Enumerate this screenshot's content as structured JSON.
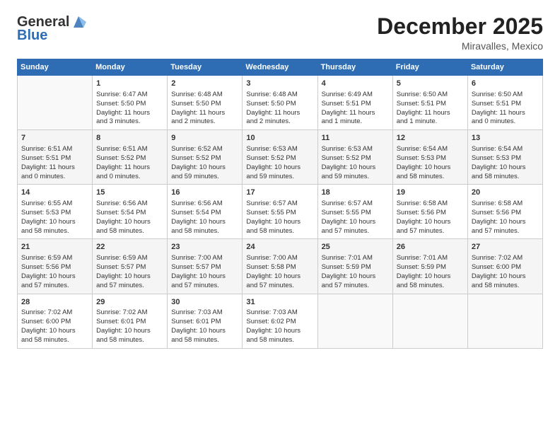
{
  "header": {
    "logo_line1": "General",
    "logo_line2": "Blue",
    "month": "December 2025",
    "location": "Miravalles, Mexico"
  },
  "weekdays": [
    "Sunday",
    "Monday",
    "Tuesday",
    "Wednesday",
    "Thursday",
    "Friday",
    "Saturday"
  ],
  "weeks": [
    [
      {
        "day": "",
        "info": ""
      },
      {
        "day": "1",
        "info": "Sunrise: 6:47 AM\nSunset: 5:50 PM\nDaylight: 11 hours\nand 3 minutes."
      },
      {
        "day": "2",
        "info": "Sunrise: 6:48 AM\nSunset: 5:50 PM\nDaylight: 11 hours\nand 2 minutes."
      },
      {
        "day": "3",
        "info": "Sunrise: 6:48 AM\nSunset: 5:50 PM\nDaylight: 11 hours\nand 2 minutes."
      },
      {
        "day": "4",
        "info": "Sunrise: 6:49 AM\nSunset: 5:51 PM\nDaylight: 11 hours\nand 1 minute."
      },
      {
        "day": "5",
        "info": "Sunrise: 6:50 AM\nSunset: 5:51 PM\nDaylight: 11 hours\nand 1 minute."
      },
      {
        "day": "6",
        "info": "Sunrise: 6:50 AM\nSunset: 5:51 PM\nDaylight: 11 hours\nand 0 minutes."
      }
    ],
    [
      {
        "day": "7",
        "info": "Sunrise: 6:51 AM\nSunset: 5:51 PM\nDaylight: 11 hours\nand 0 minutes."
      },
      {
        "day": "8",
        "info": "Sunrise: 6:51 AM\nSunset: 5:52 PM\nDaylight: 11 hours\nand 0 minutes."
      },
      {
        "day": "9",
        "info": "Sunrise: 6:52 AM\nSunset: 5:52 PM\nDaylight: 10 hours\nand 59 minutes."
      },
      {
        "day": "10",
        "info": "Sunrise: 6:53 AM\nSunset: 5:52 PM\nDaylight: 10 hours\nand 59 minutes."
      },
      {
        "day": "11",
        "info": "Sunrise: 6:53 AM\nSunset: 5:52 PM\nDaylight: 10 hours\nand 59 minutes."
      },
      {
        "day": "12",
        "info": "Sunrise: 6:54 AM\nSunset: 5:53 PM\nDaylight: 10 hours\nand 58 minutes."
      },
      {
        "day": "13",
        "info": "Sunrise: 6:54 AM\nSunset: 5:53 PM\nDaylight: 10 hours\nand 58 minutes."
      }
    ],
    [
      {
        "day": "14",
        "info": "Sunrise: 6:55 AM\nSunset: 5:53 PM\nDaylight: 10 hours\nand 58 minutes."
      },
      {
        "day": "15",
        "info": "Sunrise: 6:56 AM\nSunset: 5:54 PM\nDaylight: 10 hours\nand 58 minutes."
      },
      {
        "day": "16",
        "info": "Sunrise: 6:56 AM\nSunset: 5:54 PM\nDaylight: 10 hours\nand 58 minutes."
      },
      {
        "day": "17",
        "info": "Sunrise: 6:57 AM\nSunset: 5:55 PM\nDaylight: 10 hours\nand 58 minutes."
      },
      {
        "day": "18",
        "info": "Sunrise: 6:57 AM\nSunset: 5:55 PM\nDaylight: 10 hours\nand 57 minutes."
      },
      {
        "day": "19",
        "info": "Sunrise: 6:58 AM\nSunset: 5:56 PM\nDaylight: 10 hours\nand 57 minutes."
      },
      {
        "day": "20",
        "info": "Sunrise: 6:58 AM\nSunset: 5:56 PM\nDaylight: 10 hours\nand 57 minutes."
      }
    ],
    [
      {
        "day": "21",
        "info": "Sunrise: 6:59 AM\nSunset: 5:56 PM\nDaylight: 10 hours\nand 57 minutes."
      },
      {
        "day": "22",
        "info": "Sunrise: 6:59 AM\nSunset: 5:57 PM\nDaylight: 10 hours\nand 57 minutes."
      },
      {
        "day": "23",
        "info": "Sunrise: 7:00 AM\nSunset: 5:57 PM\nDaylight: 10 hours\nand 57 minutes."
      },
      {
        "day": "24",
        "info": "Sunrise: 7:00 AM\nSunset: 5:58 PM\nDaylight: 10 hours\nand 57 minutes."
      },
      {
        "day": "25",
        "info": "Sunrise: 7:01 AM\nSunset: 5:59 PM\nDaylight: 10 hours\nand 57 minutes."
      },
      {
        "day": "26",
        "info": "Sunrise: 7:01 AM\nSunset: 5:59 PM\nDaylight: 10 hours\nand 58 minutes."
      },
      {
        "day": "27",
        "info": "Sunrise: 7:02 AM\nSunset: 6:00 PM\nDaylight: 10 hours\nand 58 minutes."
      }
    ],
    [
      {
        "day": "28",
        "info": "Sunrise: 7:02 AM\nSunset: 6:00 PM\nDaylight: 10 hours\nand 58 minutes."
      },
      {
        "day": "29",
        "info": "Sunrise: 7:02 AM\nSunset: 6:01 PM\nDaylight: 10 hours\nand 58 minutes."
      },
      {
        "day": "30",
        "info": "Sunrise: 7:03 AM\nSunset: 6:01 PM\nDaylight: 10 hours\nand 58 minutes."
      },
      {
        "day": "31",
        "info": "Sunrise: 7:03 AM\nSunset: 6:02 PM\nDaylight: 10 hours\nand 58 minutes."
      },
      {
        "day": "",
        "info": ""
      },
      {
        "day": "",
        "info": ""
      },
      {
        "day": "",
        "info": ""
      }
    ]
  ]
}
